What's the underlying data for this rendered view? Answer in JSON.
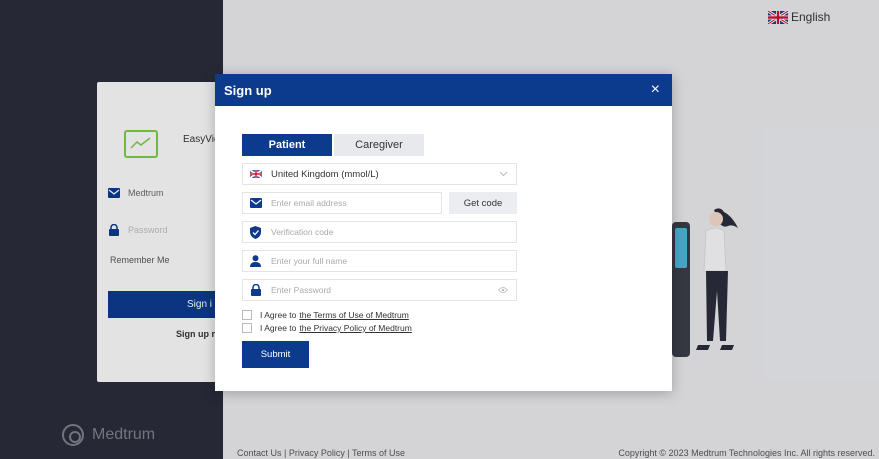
{
  "language": {
    "label": "English",
    "flag_icon": "uk-flag-icon"
  },
  "login": {
    "app_name": "EasyVie",
    "username_value": "Medtrum",
    "password_placeholder": "Password",
    "remember_label": "Remember Me",
    "signin_label": "Sign i",
    "signup_label": "Sign up r"
  },
  "brand": {
    "name": "Medtrum"
  },
  "footer": {
    "links": "Contact Us | Privacy Policy | Terms of Use",
    "copyright": "Copyright © 2023 Medtrum Technologies Inc. All rights reserved."
  },
  "modal": {
    "title": "Sign up",
    "close_glyph": "×",
    "tabs": [
      {
        "label": "Patient",
        "active": true
      },
      {
        "label": "Caregiver",
        "active": false
      }
    ],
    "region_value": "United Kingdom (mmol/L)",
    "email_placeholder": "Enter email address",
    "get_code_label": "Get code",
    "verification_placeholder": "Verification code",
    "fullname_placeholder": "Enter your full name",
    "password_placeholder": "Enter Password",
    "agree_prefix": "I Agree to",
    "terms_link": "the Terms of Use of Medtrum",
    "privacy_link": "the Privacy Policy of Medtrum",
    "submit_label": "Submit"
  },
  "colors": {
    "primary": "#0c3a8c",
    "sidebar": "#2a2d3a",
    "logo_green": "#7ac943"
  }
}
